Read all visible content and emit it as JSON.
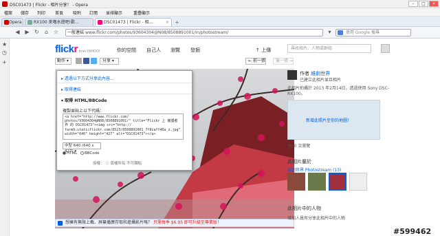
{
  "browser": {
    "title": "DSC01473 | Flickr - 相片分享！ - Opera",
    "menu": [
      "檔案",
      "儲存",
      "列印",
      "首頁",
      "吸附",
      "訂閱",
      "並排顯示",
      "重疊顯示"
    ],
    "tabs": [
      {
        "label": "Opera"
      },
      {
        "label": "RX100 來嚕水燈吧!歡..."
      },
      {
        "label": "DSC01473 | Flickr - 相..."
      }
    ],
    "address_prefix": "一般連結",
    "url": "www.flickr.com/photos/93604304@N08/8508891001/in/photostream/",
    "search_placeholder": "使用 Google 搜尋"
  },
  "flickr": {
    "logo": "flickr",
    "logo_sub": "from YAHOO!",
    "nav": [
      "你的空間",
      "自己人",
      "瀏覽",
      "發掘"
    ],
    "upload": "上傳",
    "search_placeholder": "尋找相片、人物或群組",
    "actions": "動作",
    "share": "分享",
    "prev": "前一張",
    "next": "後一張",
    "popup": {
      "sec1": "透過以下方式分享此內容...",
      "sec2": "取得連結",
      "sec3": "取得 HTML/BBCode",
      "instruction": "複製並貼上以下代碼：",
      "code": "<a href=\"http://www.flickr.com/\nphotos/93604304@N08/8508891001/\" title=\"Flickr 上 擁護者\n界 的 DSC01473\"><img src=\"http://\nfarm9.staticflickr.com/8523/8508891001_7f8caff46a_z.jpg\"\nwidth=\"640\" height=\"427\" alt=\"DSC01473\"></a>",
      "size": "中型 640 (640 x 427)",
      "html": "HTML",
      "bbcode": "BBCode",
      "license": "授權： ⓒ 版權所有 不可轉貼"
    },
    "banner": {
      "text": "想擁有無限上載、屏棄播廣存取和進攝影片嗎？",
      "highlight": "只需每季 $6.95 即可升級至專業版！"
    },
    "owner": {
      "label": "作者",
      "name": "維創世界",
      "sub": "已建立此相片並且相片"
    },
    "taken": "此相片拍攝於 2013 年2月14日，透過使用 Sony DSC-RX100。",
    "map_link": "新增此照片至你的地圖！",
    "views": "0 次瀏覽",
    "belongs": "此相片屬於",
    "photostream": "維創世界 Photostream (13)",
    "people_heading": "此相片中的人物",
    "people_text": "增加人員有分享此相片中的人物",
    "watermark": "#599462"
  }
}
